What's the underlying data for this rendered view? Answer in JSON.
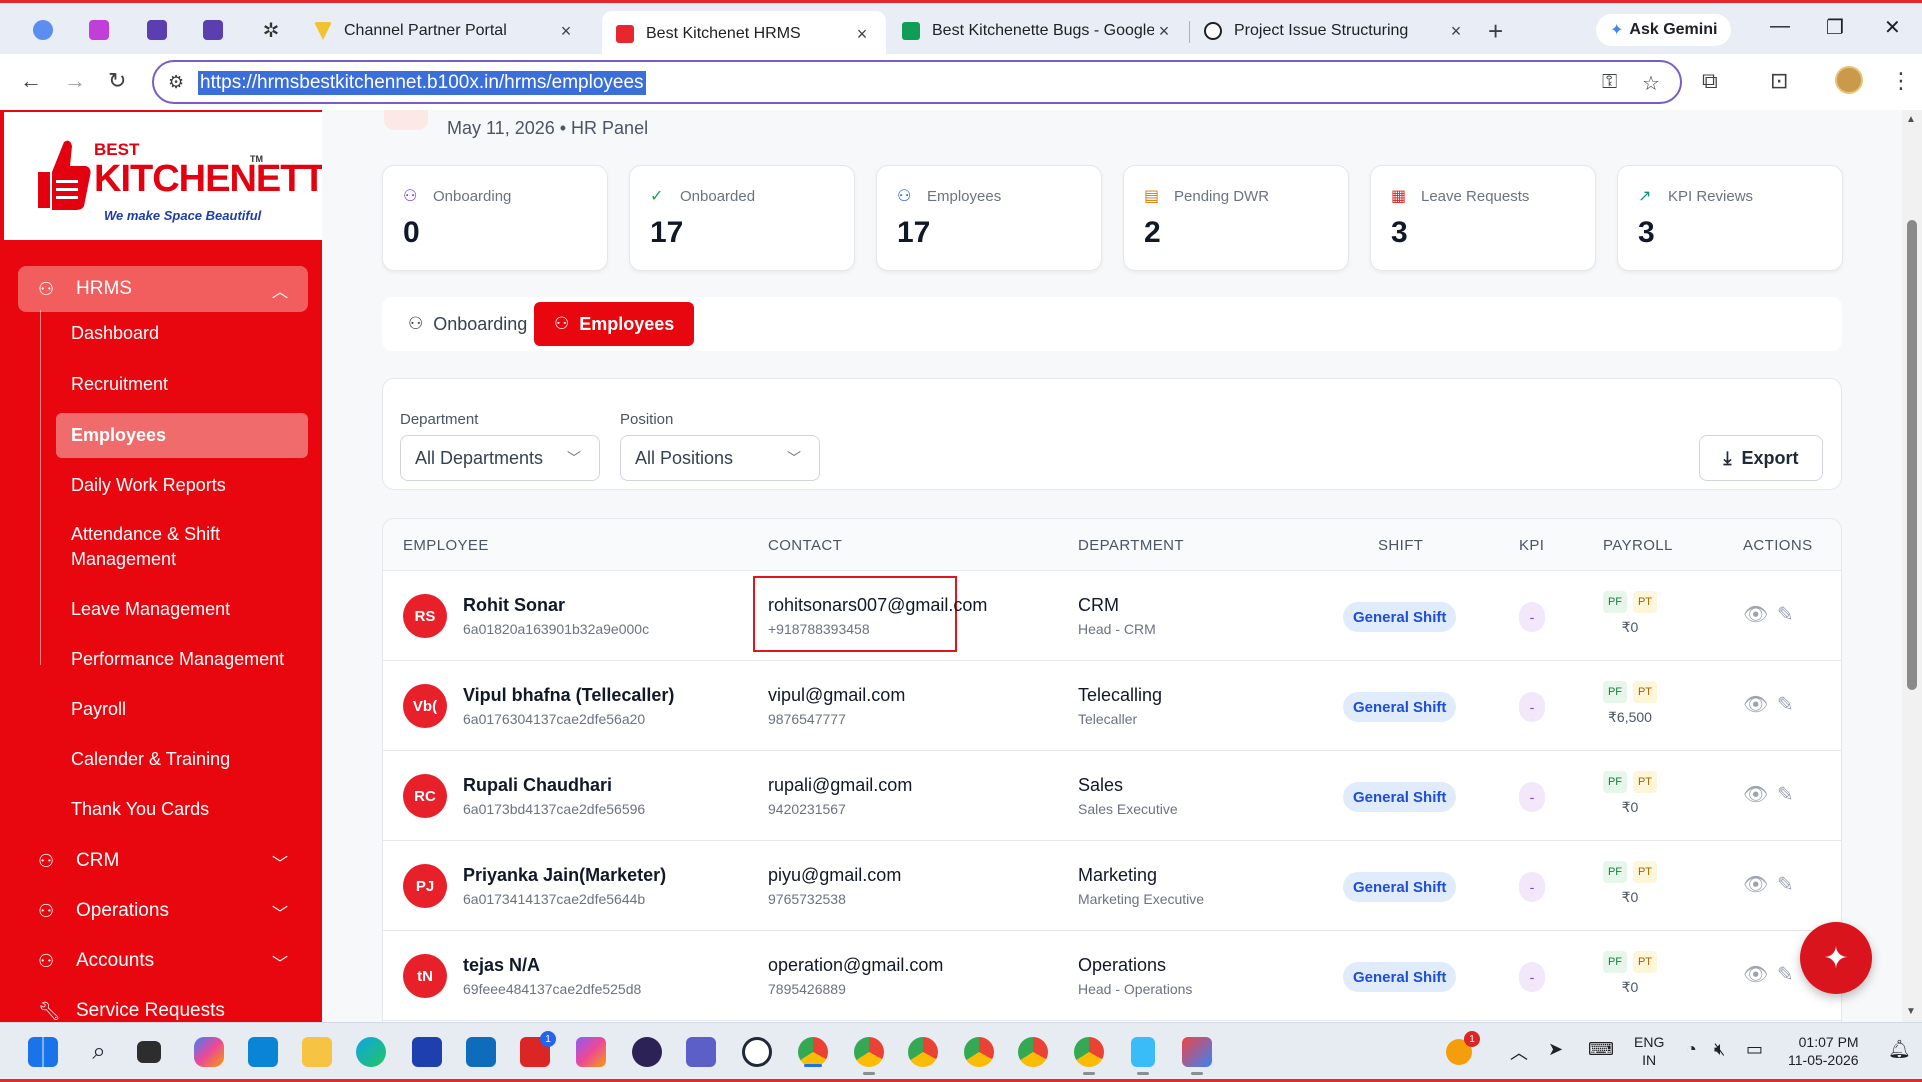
{
  "browser": {
    "tabs": [
      {
        "title": "Channel Partner Portal",
        "icon_color": "#f1c232",
        "active": false
      },
      {
        "title": "Best Kitchenet HRMS",
        "icon_color": "#e8262d",
        "active": true
      },
      {
        "title": "Best Kitchenette Bugs - Google",
        "icon_color": "#0f9d58",
        "active": false
      },
      {
        "title": "Project Issue Structuring",
        "icon_color": "#202124",
        "active": false
      }
    ],
    "gemini_label": "Ask Gemini",
    "url": "https://hrmsbestkitchennet.b100x.in/hrms/employees"
  },
  "logo": {
    "best": "BEST",
    "word": "KITCHENETTE",
    "tm": "TM",
    "tagline": "We make Space Beautiful"
  },
  "sidebar": {
    "parents": [
      {
        "label": "HRMS",
        "open": true,
        "icon": "users-icon"
      },
      {
        "label": "CRM",
        "open": false,
        "icon": "users-icon"
      },
      {
        "label": "Operations",
        "open": false,
        "icon": "users-icon"
      },
      {
        "label": "Accounts",
        "open": false,
        "icon": "users-icon"
      },
      {
        "label": "Service Requests",
        "open": false,
        "icon": "wrench-icon"
      }
    ],
    "hrms_items": [
      {
        "label": "Dashboard"
      },
      {
        "label": "Recruitment"
      },
      {
        "label": "Employees",
        "active": true
      },
      {
        "label": "Daily Work Reports"
      },
      {
        "label": "Attendance & Shift Management"
      },
      {
        "label": "Leave Management"
      },
      {
        "label": "Performance Management"
      },
      {
        "label": "Payroll"
      },
      {
        "label": "Calender & Training"
      },
      {
        "label": "Thank You Cards"
      }
    ]
  },
  "header": {
    "subtitle": "May 11, 2026 • HR Panel"
  },
  "stats": [
    {
      "label": "Onboarding",
      "value": "0",
      "icon": "user-plus-icon",
      "color": "#7c3aed"
    },
    {
      "label": "Onboarded",
      "value": "17",
      "icon": "check-circle-icon",
      "color": "#16a34a"
    },
    {
      "label": "Employees",
      "value": "17",
      "icon": "users-icon",
      "color": "#2563eb"
    },
    {
      "label": "Pending DWR",
      "value": "2",
      "icon": "clipboard-icon",
      "color": "#d97706"
    },
    {
      "label": "Leave Requests",
      "value": "3",
      "icon": "calendar-icon",
      "color": "#dc2626"
    },
    {
      "label": "KPI Reviews",
      "value": "3",
      "icon": "trending-up-icon",
      "color": "#0d9488"
    }
  ],
  "view_tabs": [
    {
      "label": "Onboarding",
      "active": false
    },
    {
      "label": "Employees",
      "active": true
    }
  ],
  "filters": {
    "department_label": "Department",
    "department_value": "All Departments",
    "position_label": "Position",
    "position_value": "All Positions",
    "export_label": "Export"
  },
  "table": {
    "columns": [
      "EMPLOYEE",
      "CONTACT",
      "DEPARTMENT",
      "SHIFT",
      "KPI",
      "PAYROLL",
      "ACTIONS"
    ],
    "rows": [
      {
        "initials": "RS",
        "name": "Rohit Sonar",
        "id": "6a01820a163901b32a9e000c",
        "email": "rohitsonars007@gmail.com",
        "phone": "+918788393458",
        "dept": "CRM",
        "role": "Head - CRM",
        "shift": "General Shift",
        "kpi": "-",
        "pf": "PF",
        "pt": "PT",
        "amount": "₹0",
        "highlight": true
      },
      {
        "initials": "Vb(",
        "name": "Vipul bhafna (Tellecaller)",
        "id": "6a0176304137cae2dfe56a20",
        "email": "vipul@gmail.com",
        "phone": "9876547777",
        "dept": "Telecalling",
        "role": "Telecaller",
        "shift": "General Shift",
        "kpi": "-",
        "pf": "PF",
        "pt": "PT",
        "amount": "₹6,500"
      },
      {
        "initials": "RC",
        "name": "Rupali Chaudhari",
        "id": "6a0173bd4137cae2dfe56596",
        "email": "rupali@gmail.com",
        "phone": "9420231567",
        "dept": "Sales",
        "role": "Sales Executive",
        "shift": "General Shift",
        "kpi": "-",
        "pf": "PF",
        "pt": "PT",
        "amount": "₹0"
      },
      {
        "initials": "PJ",
        "name": "Priyanka Jain(Marketer)",
        "id": "6a0173414137cae2dfe5644b",
        "email": "piyu@gmail.com",
        "phone": "9765732538",
        "dept": "Marketing",
        "role": "Marketing Executive",
        "shift": "General Shift",
        "kpi": "-",
        "pf": "PF",
        "pt": "PT",
        "amount": "₹0"
      },
      {
        "initials": "tN",
        "name": "tejas N/A",
        "id": "69feee484137cae2dfe525d8",
        "email": "operation@gmail.com",
        "phone": "7895426889",
        "dept": "Operations",
        "role": "Head - Operations",
        "shift": "General Shift",
        "kpi": "-",
        "pf": "PF",
        "pt": "PT",
        "amount": "₹0"
      }
    ]
  },
  "taskbar": {
    "lang_top": "ENG",
    "lang_bottom": "IN",
    "time": "01:07 PM",
    "date": "11-05-2026",
    "badge_l": "1",
    "badge_notify": "1"
  }
}
